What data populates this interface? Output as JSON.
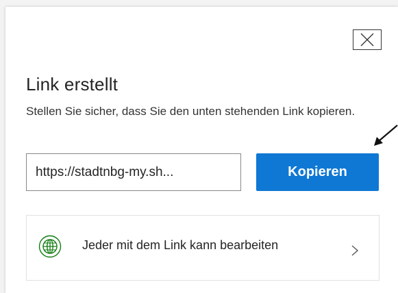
{
  "dialog": {
    "title": "Link erstellt",
    "description": "Stellen Sie sicher, dass Sie den unten stehenden Link kopieren.",
    "link_value": "https://stadtnbg-my.sh...",
    "copy_label": "Kopieren",
    "permission_label": "Jeder mit dem Link kann bearbeiten",
    "close_icon": "close-icon",
    "permission_icon": "globe-icon",
    "chevron_icon": "chevron-right-icon"
  },
  "colors": {
    "accent": "#0f78d4",
    "globe": "#107c10"
  }
}
